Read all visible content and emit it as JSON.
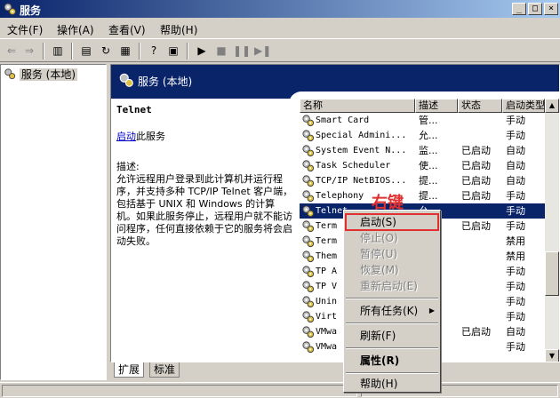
{
  "window": {
    "title": "服务",
    "minimize": "_",
    "maximize": "□",
    "close": "×"
  },
  "menu": [
    "文件(F)",
    "操作(A)",
    "查看(V)",
    "帮助(H)"
  ],
  "tree": {
    "root": "服务 (本地)"
  },
  "header": {
    "title": "服务 (本地)"
  },
  "description": {
    "service_name": "Telnet",
    "start_link": "启动",
    "start_suffix": "此服务",
    "label": "描述:",
    "text": "允许远程用户登录到此计算机并运行程序，并支持多种 TCP/IP Telnet 客户端，包括基于 UNIX 和 Windows 的计算机。如果此服务停止，远程用户就不能访问程序，任何直接依赖于它的服务将会启动失败。"
  },
  "table": {
    "columns": [
      "名称",
      "描述",
      "状态",
      "启动类型"
    ],
    "rows": [
      {
        "name": "Smart Card",
        "desc": "管...",
        "status": "",
        "start": "手动"
      },
      {
        "name": "Special Admini...",
        "desc": "允...",
        "status": "",
        "start": "手动"
      },
      {
        "name": "System Event N...",
        "desc": "监...",
        "status": "已启动",
        "start": "自动"
      },
      {
        "name": "Task Scheduler",
        "desc": "使...",
        "status": "已启动",
        "start": "自动"
      },
      {
        "name": "TCP/IP NetBIOS...",
        "desc": "提...",
        "status": "已启动",
        "start": "自动"
      },
      {
        "name": "Telephony",
        "desc": "提...",
        "status": "已启动",
        "start": "手动"
      },
      {
        "name": "Telnet",
        "desc": "允...",
        "status": "",
        "start": "手动"
      },
      {
        "name": "Term",
        "desc": "",
        "status": "已启动",
        "start": "手动"
      },
      {
        "name": "Term",
        "desc": "",
        "status": "",
        "start": "禁用"
      },
      {
        "name": "Them",
        "desc": "",
        "status": "",
        "start": "禁用"
      },
      {
        "name": "TP A",
        "desc": "",
        "status": "",
        "start": "手动"
      },
      {
        "name": "TP V",
        "desc": "",
        "status": "",
        "start": "手动"
      },
      {
        "name": "Unin",
        "desc": "",
        "status": "",
        "start": "手动"
      },
      {
        "name": "Virt",
        "desc": "",
        "status": "",
        "start": "手动"
      },
      {
        "name": "VMwa",
        "desc": "",
        "status": "已启动",
        "start": "自动"
      },
      {
        "name": "VMwa",
        "desc": "",
        "status": "",
        "start": "手动"
      }
    ]
  },
  "tabs": [
    "扩展",
    "标准"
  ],
  "context_menu": {
    "items": [
      {
        "label": "启动(S)",
        "disabled": false
      },
      {
        "label": "停止(O)",
        "disabled": true
      },
      {
        "label": "暂停(U)",
        "disabled": true
      },
      {
        "label": "恢复(M)",
        "disabled": true
      },
      {
        "label": "重新启动(E)",
        "disabled": true
      },
      {
        "label": "所有任务(K)",
        "disabled": false
      },
      {
        "label": "刷新(F)",
        "disabled": false
      },
      {
        "label": "属性(R)",
        "disabled": false
      },
      {
        "label": "帮助(H)",
        "disabled": false
      }
    ]
  },
  "annotation": "右键",
  "colors": {
    "selection": "#0a246a",
    "annotation": "#e03030"
  }
}
